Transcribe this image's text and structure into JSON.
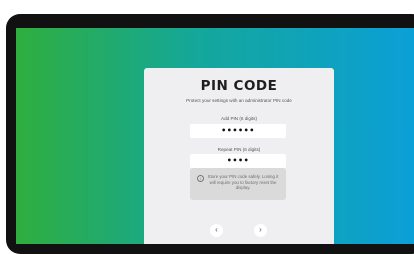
{
  "dialog": {
    "title": "PIN CODE",
    "subtitle": "Protect your settings with an administrator PIN code",
    "add_pin_label": "Add PIN (6 digits)",
    "add_pin_value": "••••••",
    "repeat_pin_label": "Repeat PIN (6 digits)",
    "repeat_pin_value": "••••",
    "info_icon": "info-icon",
    "info_glyph": "i",
    "info_text": "Store your PIN code safely. Losing it will require you to factory reset the display.",
    "back_button_glyph": "‹",
    "next_button_glyph": "›"
  },
  "colors": {
    "gradient_start": "#2fae3e",
    "gradient_mid": "#14a79a",
    "gradient_end": "#0b9fd8",
    "card_background": "#efeef1",
    "info_box_background": "#dadada"
  }
}
